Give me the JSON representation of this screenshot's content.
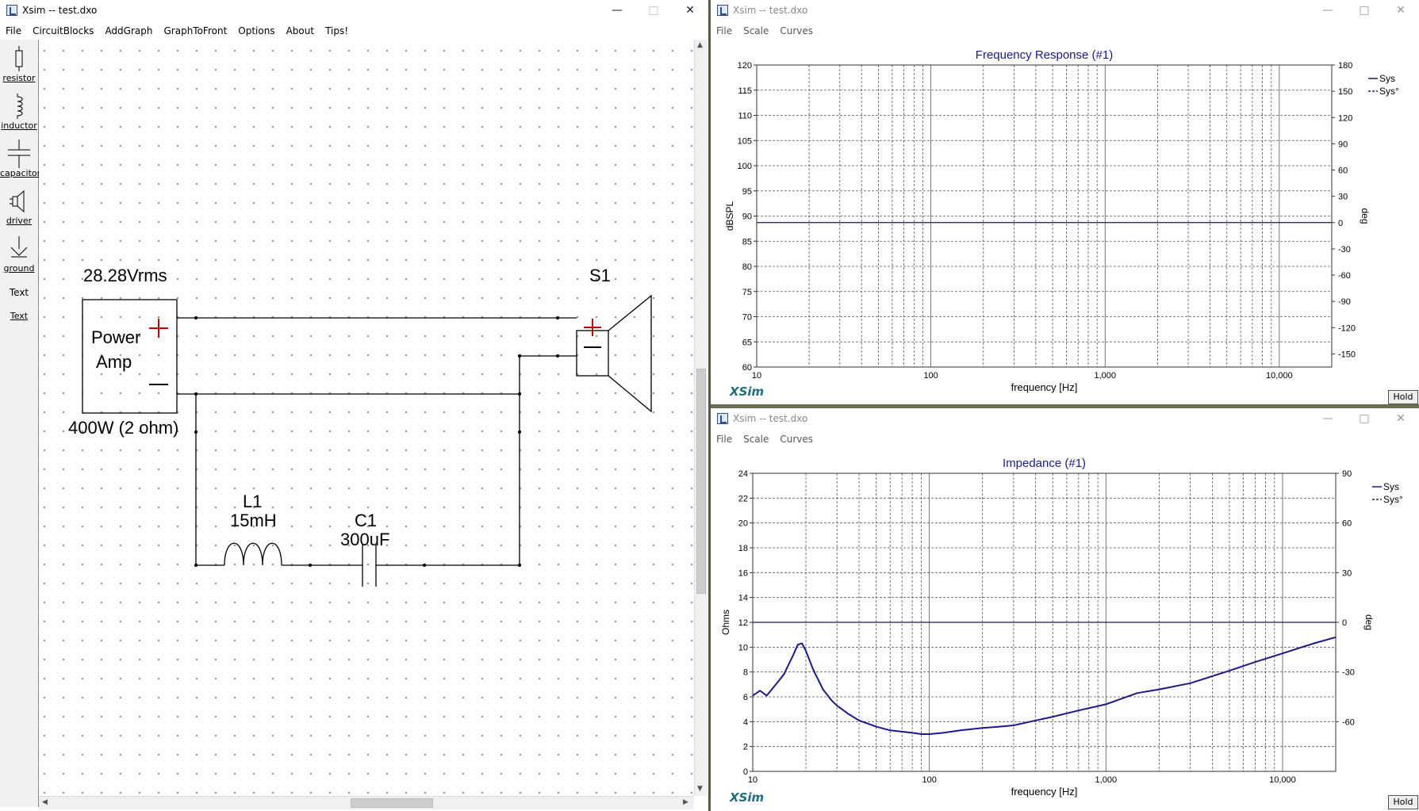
{
  "left_window": {
    "title": "Xsim -- test.dxo",
    "menu": [
      "File",
      "CircuitBlocks",
      "AddGraph",
      "GraphToFront",
      "Options",
      "About",
      "Tips!"
    ],
    "toolbox": [
      {
        "label": "resistor",
        "icon": "resistor-icon"
      },
      {
        "label": "inductor",
        "icon": "inductor-icon"
      },
      {
        "label": "capacitor",
        "icon": "capacitor-icon"
      },
      {
        "label": "driver",
        "icon": "speaker-icon"
      },
      {
        "label": "ground",
        "icon": "ground-icon"
      },
      {
        "label": "Text",
        "icon": "text-icon"
      }
    ],
    "text_tool_preview": "Text",
    "circuit": {
      "amp_voltage": "28.28Vrms",
      "amp_line1": "Power",
      "amp_line2": "Amp",
      "amp_power": "400W (2 ohm)",
      "speaker_label": "S1",
      "inductor_name": "L1",
      "inductor_value": "15mH",
      "capacitor_name": "C1",
      "capacitor_value": "300uF"
    }
  },
  "freq_window": {
    "title": "Xsim -- test.dxo",
    "menu": [
      "File",
      "Scale",
      "Curves"
    ],
    "hold_label": "Hold",
    "brand": "XSim"
  },
  "imp_window": {
    "title": "Xsim -- test.dxo",
    "menu": [
      "File",
      "Scale",
      "Curves"
    ],
    "hold_label": "Hold",
    "brand": "XSim"
  },
  "chart_data": [
    {
      "type": "line",
      "title": "Frequency Response (#1)",
      "xlabel": "frequency [Hz]",
      "ylabel": "dBSPL",
      "y2label": "deg",
      "xscale": "log",
      "xlim": [
        10,
        20000
      ],
      "ylim": [
        60,
        120
      ],
      "y2lim": [
        -165,
        180
      ],
      "xticks": [
        10,
        100,
        1000,
        10000
      ],
      "xtick_labels": [
        "10",
        "100",
        "1,000",
        "10,000"
      ],
      "yticks": [
        60,
        65,
        70,
        75,
        80,
        85,
        90,
        95,
        100,
        105,
        110,
        115,
        120
      ],
      "y2ticks": [
        -150,
        -120,
        -90,
        -60,
        -30,
        0,
        30,
        60,
        90,
        120,
        150,
        180
      ],
      "grid": true,
      "legend_position": "top-right",
      "series": [
        {
          "name": "Sys",
          "style": "solid",
          "color": "#1a1a8c",
          "x": [],
          "y": []
        },
        {
          "name": "Sys°",
          "style": "dashed",
          "color": "#1a1a8c",
          "x": [],
          "y": []
        }
      ]
    },
    {
      "type": "line",
      "title": "Impedance (#1)",
      "xlabel": "frequency [Hz]",
      "ylabel": "Ohms",
      "y2label": "deg",
      "xscale": "log",
      "xlim": [
        10,
        20000
      ],
      "ylim": [
        0,
        24
      ],
      "y2lim": [
        -90,
        90
      ],
      "xticks": [
        10,
        100,
        1000,
        10000
      ],
      "xtick_labels": [
        "10",
        "100",
        "1,000",
        "10,000"
      ],
      "yticks": [
        0,
        2,
        4,
        6,
        8,
        10,
        12,
        14,
        16,
        18,
        20,
        22,
        24
      ],
      "y2ticks": [
        -60,
        -30,
        0,
        30,
        60,
        90
      ],
      "grid": true,
      "legend_position": "top-right",
      "series": [
        {
          "name": "Sys",
          "style": "solid",
          "color": "#1a1a8c",
          "x": [
            10,
            11,
            12,
            13,
            15,
            17,
            18,
            19,
            20,
            22,
            25,
            28,
            30,
            35,
            40,
            50,
            60,
            70,
            80,
            90,
            100,
            120,
            150,
            200,
            250,
            300,
            400,
            500,
            700,
            1000,
            1500,
            2000,
            3000,
            5000,
            7000,
            10000,
            15000,
            20000
          ],
          "y": [
            6.1,
            6.5,
            6.1,
            6.7,
            7.8,
            9.4,
            10.2,
            10.3,
            9.7,
            8.2,
            6.6,
            5.7,
            5.3,
            4.6,
            4.1,
            3.6,
            3.3,
            3.2,
            3.1,
            3.0,
            3.0,
            3.1,
            3.3,
            3.5,
            3.6,
            3.7,
            4.1,
            4.4,
            4.9,
            5.4,
            6.3,
            6.6,
            7.1,
            8.1,
            8.8,
            9.5,
            10.3,
            10.8
          ]
        },
        {
          "name": "Sys°",
          "style": "dashed",
          "color": "#1a1a8c",
          "x": [],
          "y": []
        }
      ]
    }
  ]
}
